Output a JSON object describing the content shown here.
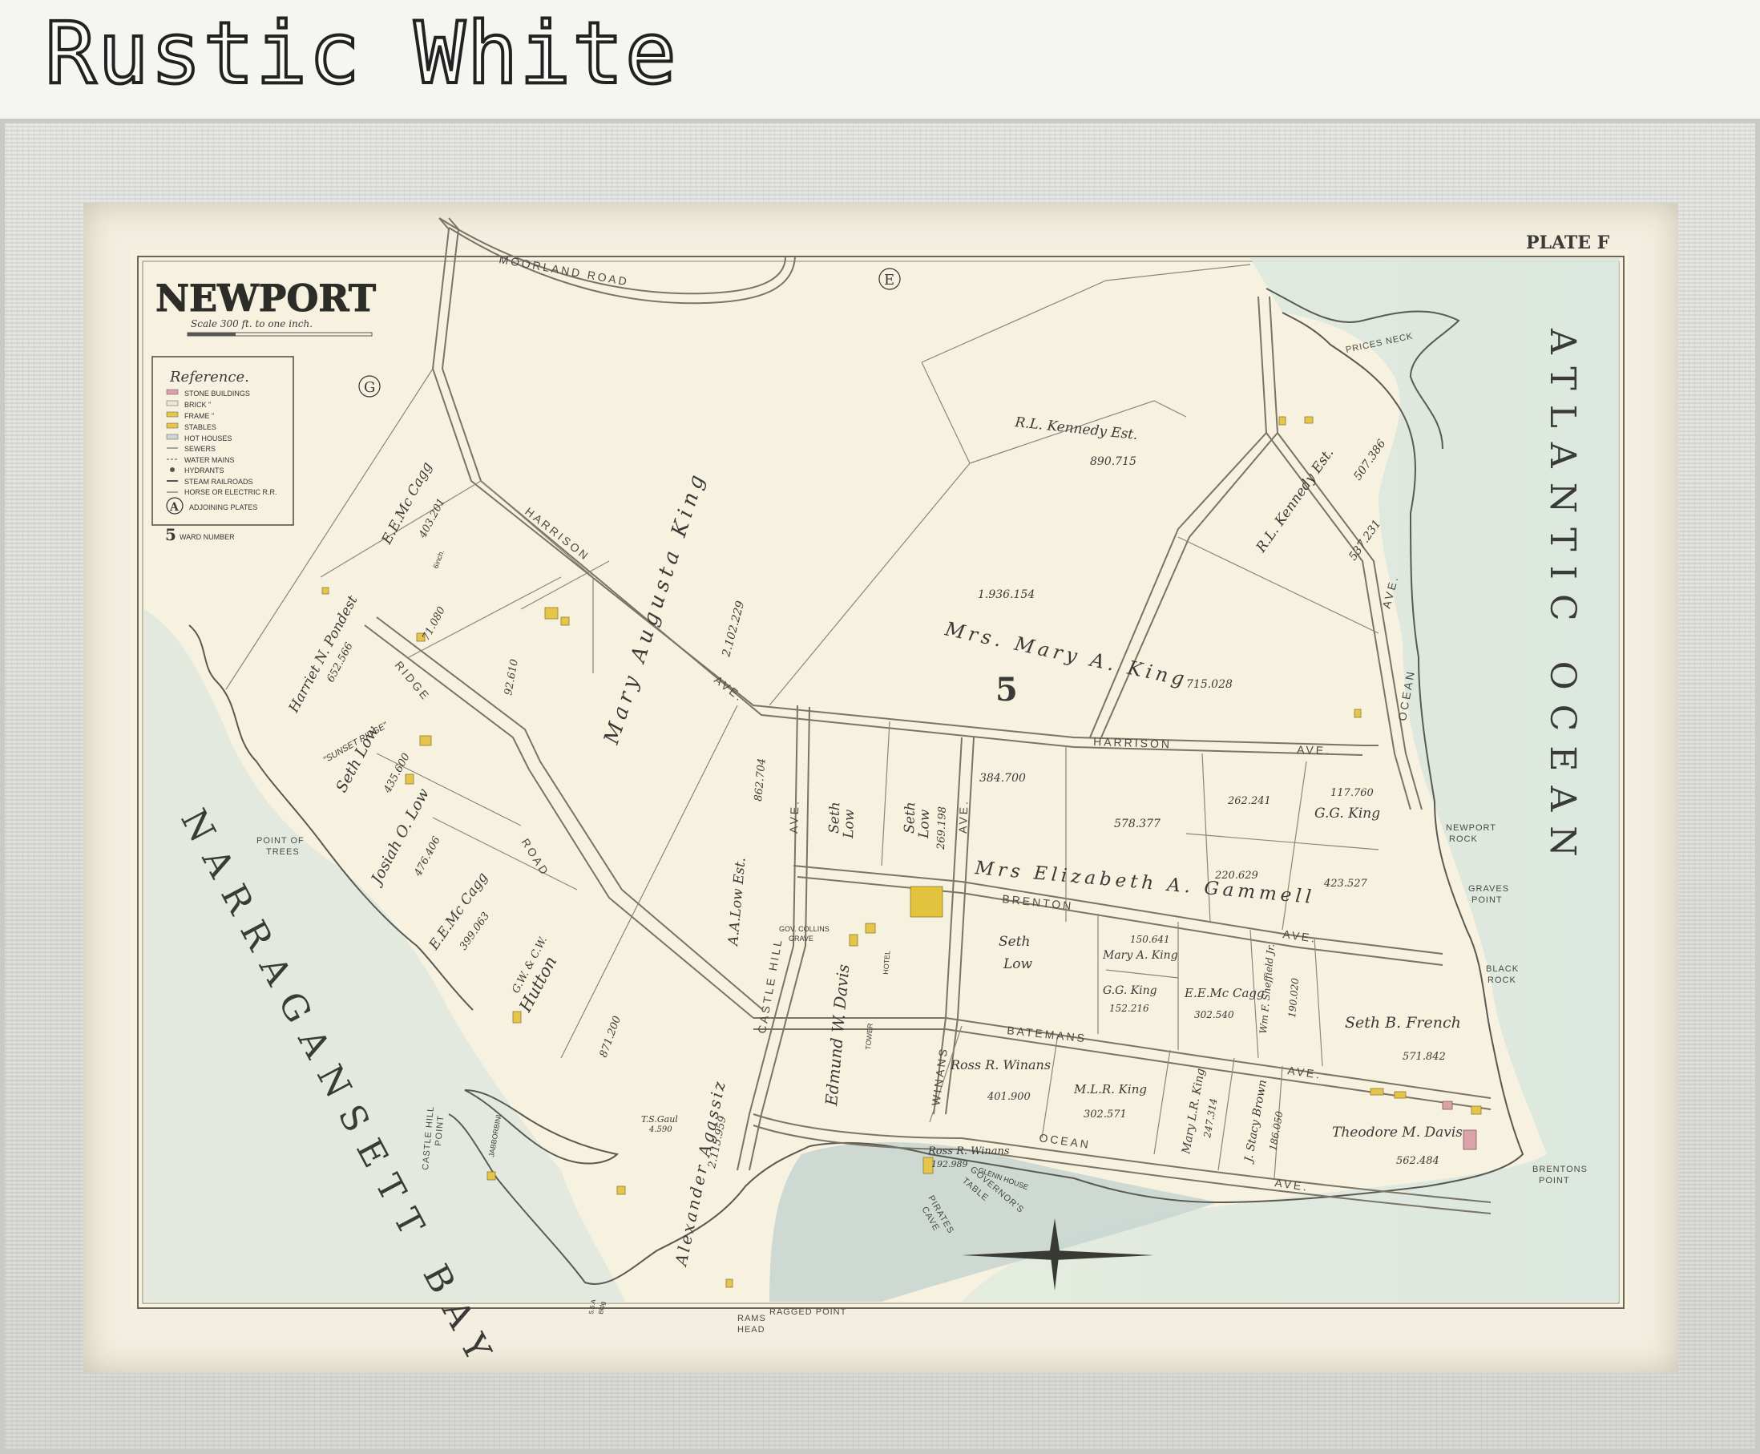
{
  "banner": {
    "title": "Rustic White"
  },
  "map": {
    "plate": "PLATE F",
    "title": "NEWPORT",
    "scale": "Scale 300 ft. to one inch.",
    "scale_ticks": [
      "0",
      "50",
      "100",
      "150",
      "300",
      "600",
      "900"
    ],
    "ward_number": "5",
    "adjoining": [
      "E",
      "G"
    ],
    "reference": {
      "heading": "Reference.",
      "items": [
        "STONE BUILDINGS",
        "BRICK  \"",
        "FRAME  \"",
        "STABLES",
        "HOT HOUSES",
        "SEWERS",
        "WATER MAINS",
        "HYDRANTS",
        "STEAM RAILROADS",
        "HORSE OR ELECTRIC R.R.",
        "ADJOINING PLATES",
        "WARD NUMBER"
      ],
      "adjoining_symbol": "A",
      "ward_symbol": "5",
      "gauge_note": "6inch."
    },
    "water": {
      "bay": "NARRAGANSETT BAY",
      "ocean": "ATLANTIC OCEAN"
    },
    "roads": {
      "moorland": "MOORLAND  ROAD",
      "harrison_1": "HARRISON",
      "harrison_2": "AVE.",
      "harrison_3": "HARRISON",
      "harrison_4": "AVE.",
      "ridge_1": "RIDGE",
      "ridge_2": "ROAD",
      "brenton_1": "BRENTON",
      "brenton_2": "AVE.",
      "batemans_1": "BATEMANS",
      "batemans_2": "AVE.",
      "ocean_1": "OCEAN",
      "ocean_2": "AVE.",
      "ocean_ne_1": "OCEAN",
      "ocean_ne_2": "AVE.",
      "castle_hill": "CASTLE  HILL",
      "castle_hill_ave": "AVE.",
      "winans": "WINANS",
      "winans_ave": "AVE."
    },
    "points": {
      "prices_neck": "PRICES NECK",
      "newport_rock_1": "NEWPORT",
      "newport_rock_2": "ROCK",
      "graves_point_1": "GRAVES",
      "graves_point_2": "POINT",
      "black_rock_1": "BLACK",
      "black_rock_2": "ROCK",
      "brentons_point_1": "BRENTONS",
      "brentons_point_2": "POINT",
      "point_of_trees_1": "POINT OF",
      "point_of_trees_2": "TREES",
      "castle_hill_point_1": "CASTLE HILL",
      "castle_hill_point_2": "POINT",
      "ragged_point": "RAGGED POINT",
      "rams_head_1": "RAMS",
      "rams_head_2": "HEAD",
      "pirates_cave_1": "PIRATES",
      "pirates_cave_2": "CAVE",
      "governors_table_1": "GOVERNOR'S",
      "governors_table_2": "TABLE"
    },
    "owners": {
      "rl_kennedy_1": "R.L. Kennedy Est.",
      "rl_kennedy_1_area": "890.715",
      "rl_kennedy_2": "R.L. Kennedy Est.",
      "rl_kennedy_2_area_a": "507.386",
      "rl_kennedy_2_area_b": "537.231",
      "mary_augusta_king": "Mary  Augusta  King",
      "mary_augusta_king_area": "2.102.229",
      "mrs_mary_king_area": "1.936.154",
      "mrs_mary_king": "Mrs. Mary    A. King",
      "mrs_mary_king_area_2": "715.028",
      "harriet_pondest": "Harriet N. Pondest",
      "harriet_area": "652.566",
      "eem_cagg_top": "E.E.Mc Cagg",
      "eem_cagg_top_area": "403.201",
      "lot_71080": "71.080",
      "lot_92610": "92.610",
      "sunset_ridge": "\"SUNSET RIDGE\"",
      "seth_low_1": "Seth Low",
      "seth_low_1_area": "435.600",
      "josiah_low": "Josiah O. Low",
      "josiah_area": "476.406",
      "eem_cagg_mid": "E.E.Mc Cagg",
      "eem_cagg_mid_area": "399.063",
      "hutton_1": "G.W. & C.W.",
      "hutton_2": "Hutton",
      "lot_871200": "871.200",
      "aa_low": "A.A.Low Est.",
      "aa_low_area": "862.704",
      "agassiz": "Alexander Agassiz",
      "agassiz_area": "2.115.959",
      "seth_low_2a": "Seth",
      "seth_low_2b": "Low",
      "seth_low_3a": "Seth",
      "seth_low_3b": "Low",
      "seth_low_3_area": "269.198",
      "lot_384700": "384.700",
      "lot_578377": "578.377",
      "lot_262241": "262.241",
      "lot_117760": "117.760",
      "gg_king_1": "G.G. King",
      "gammell": "Mrs  Elizabeth  A. Gammell",
      "lot_220629": "220.629",
      "lot_423527": "423.527",
      "gov_collins_1": "GOV. COLLINS",
      "gov_collins_2": "GRAVE",
      "davis": "Edmund W. Davis",
      "davis_tower": "TOWER",
      "hotel": "HOTEL",
      "seth_low_4a": "Seth",
      "seth_low_4b": "Low",
      "lot_150641": "150.641",
      "mary_a_king": "Mary A. King",
      "gg_king_2": "G.G. King",
      "gg_king_2_area": "152.216",
      "eem_cagg_low": "E.E.Mc Cagg",
      "eem_cagg_low_area": "302.540",
      "sheffield": "Wm F. Sheffield Jr.",
      "lot_190020": "190.020",
      "seth_french": "Seth B. French",
      "seth_french_area": "571.842",
      "ross_winans_1": "Ross R. Winans",
      "ross_winans_1_area": "401.900",
      "mlr_king": "M.L.R. King",
      "mlr_king_area": "302.571",
      "mary_lr_king": "Mary L.R. King",
      "mary_lr_king_area": "247.314",
      "stacy_brown": "J. Stacy Brown",
      "stacy_brown_area": "186.050",
      "theodore_davis": "Theodore M. Davis",
      "theodore_area": "562.484",
      "ross_winans_2": "Ross R. Winans",
      "ross_winans_2_area": "192.989",
      "glen_house": "GLENN HOUSE",
      "jabborbini": "JABBORBINI",
      "ts_gaul_1": "T.S.Gaul",
      "ts_gaul_2": "4.590",
      "small_1": "5.5.A",
      "small_2": "Bldg"
    }
  }
}
